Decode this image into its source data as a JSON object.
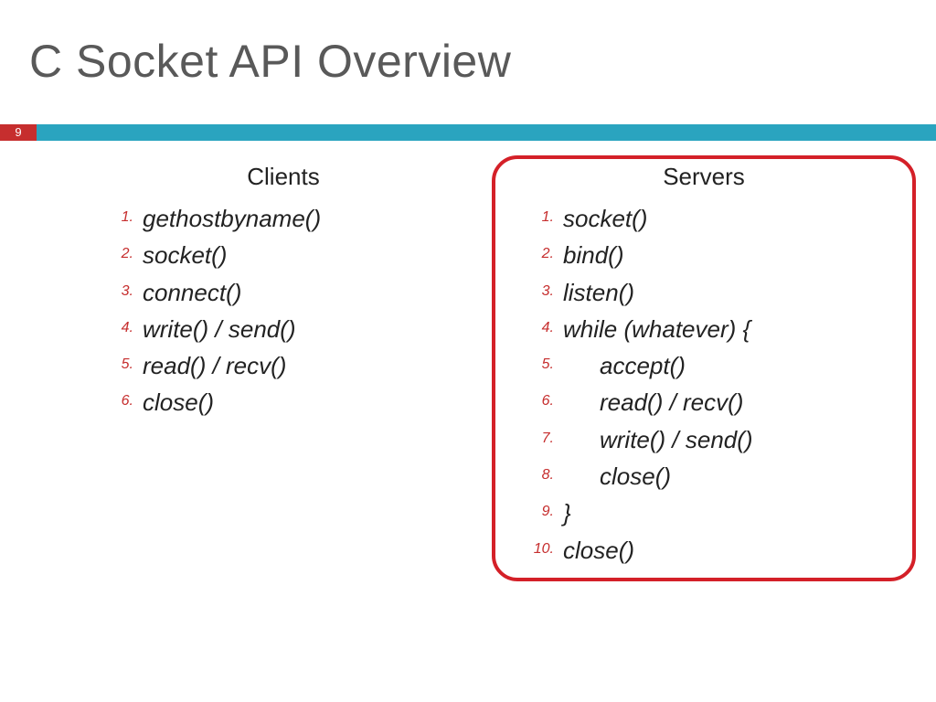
{
  "slide": {
    "title": "C Socket API Overview",
    "page_number": "9"
  },
  "columns": {
    "clients": {
      "heading": "Clients",
      "items": [
        {
          "text": "gethostbyname()",
          "indent": false
        },
        {
          "text": "socket()",
          "indent": false
        },
        {
          "text": "connect()",
          "indent": false
        },
        {
          "text": "write() / send()",
          "indent": false
        },
        {
          "text": "read() / recv()",
          "indent": false
        },
        {
          "text": "close()",
          "indent": false
        }
      ]
    },
    "servers": {
      "heading": "Servers",
      "items": [
        {
          "text": "socket()",
          "indent": false
        },
        {
          "text": "bind()",
          "indent": false
        },
        {
          "text": "listen()",
          "indent": false
        },
        {
          "text": "while (whatever) {",
          "indent": false
        },
        {
          "text": "accept()",
          "indent": true
        },
        {
          "text": "read() / recv()",
          "indent": true
        },
        {
          "text": "write() / send()",
          "indent": true
        },
        {
          "text": "close()",
          "indent": true
        },
        {
          "text": "}",
          "indent": false
        },
        {
          "text": "close()",
          "indent": false
        }
      ]
    }
  },
  "colors": {
    "accent_bar": "#2aa4bf",
    "page_badge": "#c62e2e",
    "highlight_border": "#d42028",
    "title_color": "#595959"
  }
}
